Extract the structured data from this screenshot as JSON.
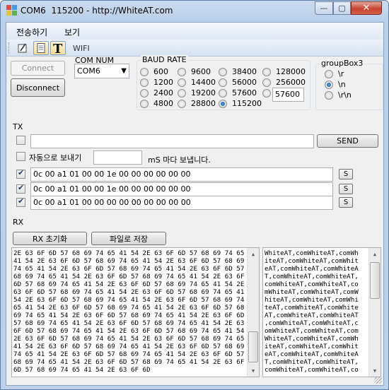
{
  "window": {
    "title": "COM6  115200 - http://WhiteAT.com",
    "minimize": "—",
    "maximize": "▢",
    "close": "✕"
  },
  "menu": {
    "items": [
      "전송하기",
      "보기"
    ]
  },
  "toolbar": {
    "wifi_label": "WIFI",
    "icons": [
      "edit-icon",
      "notepad-icon",
      "text-t-icon"
    ]
  },
  "connection": {
    "connect_label": "Connect",
    "disconnect_label": "Disconnect",
    "com_num_title": "COM NUM",
    "com_num_value": "COM6"
  },
  "baud": {
    "title": "BAUD RATE",
    "options": [
      "600",
      "1200",
      "2400",
      "4800",
      "9600",
      "14400",
      "19200",
      "28800",
      "38400",
      "56000",
      "57600",
      "115200",
      "128000",
      "256000"
    ],
    "selected": "115200",
    "custom_value": "57600"
  },
  "groupbox3": {
    "title": "groupBox3",
    "options": [
      "\\r",
      "\\n",
      "\\r\\n"
    ],
    "selected": "\\n"
  },
  "tx": {
    "label": "TX",
    "send_label": "SEND",
    "input_value": "",
    "auto_send_label": "자동으로 보내기",
    "interval_value": "",
    "interval_suffix": "mS 마다 보냅니다.",
    "rows": [
      {
        "checked": true,
        "value": "0c 00 a1 01 00 00 1e 00 00 00 00 00 00",
        "button": "S"
      },
      {
        "checked": true,
        "value": "0c 00 a1 01 00 00 1e 00 00 00 00 00 00",
        "button": "S"
      },
      {
        "checked": true,
        "value": "0c 00 a1 01 00 00 00 00 00 00 00 00 00",
        "button": "S"
      }
    ]
  },
  "rx": {
    "label": "RX",
    "reset_label": "RX 초기화",
    "save_label": "파일로 저장",
    "hex_lines": [
      "2E 63 6F 6D 57 68 69 74 65 41 54 2E 63 6F 6D 57 68 69 74 65",
      "41 54 2E 63 6F 6D 57 68 69 74 65 41 54 2E 63 6F 6D 57 68 69",
      "74 65 41 54 2E 63 6F 6D 57 68 69 74 65 41 54 2E 63 6F 6D 57",
      "68 69 74 65 41 54 2E 63 6F 6D 57 68 69 74 65 41 54 2E 63 6F",
      "6D 57 68 69 74 65 41 54 2E 63 6F 6D 57 68 69 74 65 41 54 2E",
      "63 6F 6D 57 68 69 74 65 41 54 2E 63 6F 6D 57 68 69 74 65 41",
      "54 2E 63 6F 6D 57 68 69 74 65 41 54 2E 63 6F 6D 57 68 69 74",
      "65 41 54 2E 63 6F 6D 57 68 69 74 65 41 54 2E 63 6F 6D 57 68",
      "69 74 65 41 54 2E 63 6F 6D 57 68 69 74 65 41 54 2E 63 6F 6D",
      "57 68 69 74 65 41 54 2E 63 6F 6D 57 68 69 74 65 41 54 2E 63",
      "6F 6D 57 68 69 74 65 41 54 2E 63 6F 6D 57 68 69 74 65 41 54",
      "2E 63 6F 6D 57 68 69 74 65 41 54 2E 63 6F 6D 57 68 69 74 65",
      "41 54 2E 63 6F 6D 57 68 69 74 65 41 54 2E 63 6F 6D 57 68 69",
      "74 65 41 54 2E 63 6F 6D 57 68 69 74 65 41 54 2E 63 6F 6D 57",
      "68 69 74 65 41 54 2E 63 6F 6D 57 68 69 74 65 41 54 2E 63 6F",
      "6D 57 68 69 74 65 41 54 2E 63 6F 6D"
    ],
    "text_lines": [
      "WhiteAT,comWhiteAT,comWh",
      "iteAT,comWhiteAT,comWhit",
      "eAT,comWhiteAT,comWhiteA",
      "T,comWhiteAT,comWhiteAT,",
      "comWhiteAT,comWhiteAT,co",
      "mWhiteAT,comWhiteAT,comW",
      "hiteAT,comWhiteAT,comWhi",
      "teAT,comWhiteAT,comWhite",
      "AT,comWhiteAT,comWhiteAT",
      ",comWhiteAT,comWhiteAT,c",
      "omWhiteAT,comWhiteAT,com",
      "WhiteAT,comWhiteAT,comWh",
      "iteAT,comWhiteAT,comWhit",
      "eAT,comWhiteAT,comWhiteA",
      "T,comWhiteAT,comWhiteAT,",
      "comWhiteAT,comWhiteAT,co"
    ]
  }
}
